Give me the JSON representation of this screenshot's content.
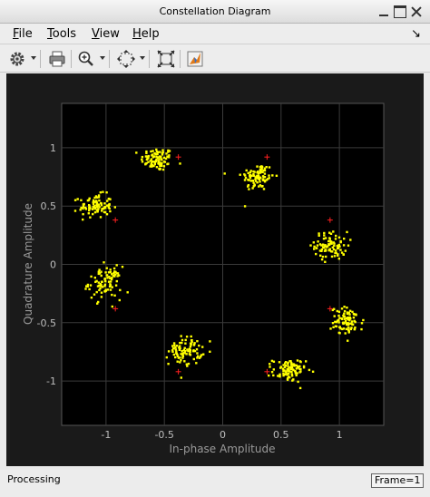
{
  "window": {
    "title": "Constellation Diagram"
  },
  "menubar": {
    "items": [
      {
        "label": "File",
        "mnemonic": "F",
        "rest": "ile"
      },
      {
        "label": "Tools",
        "mnemonic": "T",
        "rest": "ools"
      },
      {
        "label": "View",
        "mnemonic": "V",
        "rest": "iew"
      },
      {
        "label": "Help",
        "mnemonic": "H",
        "rest": "elp"
      }
    ],
    "dock_glyph": "↘"
  },
  "toolbar": {
    "buttons": [
      "settings-icon",
      "print-icon",
      "zoom-in-icon",
      "pan-icon",
      "autoscale-icon",
      "matlab-icon"
    ]
  },
  "chart_data": {
    "type": "scatter",
    "xlabel": "In-phase Amplitude",
    "ylabel": "Quadrature Amplitude",
    "xlim": [
      -1.38,
      1.38
    ],
    "ylim": [
      -1.38,
      1.38
    ],
    "xticks": [
      "-1",
      "-0.5",
      "0",
      "0.5",
      "1"
    ],
    "xtick_values": [
      -1,
      -0.5,
      0,
      0.5,
      1
    ],
    "yticks": [
      "1",
      "0.5",
      "0",
      "-0.5",
      "-1"
    ],
    "ytick_values": [
      1,
      0.5,
      0,
      -0.5,
      -1
    ],
    "grid": true,
    "series": [
      {
        "role": "received",
        "color": "#ffff00",
        "clusters": [
          {
            "x": -0.56,
            "y": 0.9,
            "sx": 0.07,
            "sy": 0.05
          },
          {
            "x": 0.3,
            "y": 0.75,
            "sx": 0.07,
            "sy": 0.06
          },
          {
            "x": -1.09,
            "y": 0.5,
            "sx": 0.07,
            "sy": 0.05
          },
          {
            "x": 0.93,
            "y": 0.16,
            "sx": 0.07,
            "sy": 0.06
          },
          {
            "x": -1.01,
            "y": -0.16,
            "sx": 0.07,
            "sy": 0.07
          },
          {
            "x": 1.07,
            "y": -0.49,
            "sx": 0.07,
            "sy": 0.06
          },
          {
            "x": -0.32,
            "y": -0.74,
            "sx": 0.07,
            "sy": 0.06
          },
          {
            "x": 0.57,
            "y": -0.91,
            "sx": 0.07,
            "sy": 0.05
          }
        ],
        "points_per_cluster": 90
      },
      {
        "role": "reference",
        "color": "#ff2020",
        "marker": "+",
        "points": [
          {
            "x": -0.38,
            "y": 0.92
          },
          {
            "x": 0.38,
            "y": 0.92
          },
          {
            "x": -0.92,
            "y": 0.38
          },
          {
            "x": 0.92,
            "y": 0.38
          },
          {
            "x": -0.92,
            "y": -0.38
          },
          {
            "x": 0.92,
            "y": -0.38
          },
          {
            "x": -0.38,
            "y": -0.92
          },
          {
            "x": 0.38,
            "y": -0.92
          }
        ]
      }
    ],
    "colors": {
      "figure_bg": "#1a1a1a",
      "axes_bg": "#000000",
      "grid": "#3a3a3a",
      "tick_text": "#bdbdbd",
      "label_text": "#9a9a9a"
    }
  },
  "status": {
    "left": "Processing",
    "frame": "Frame=1"
  }
}
